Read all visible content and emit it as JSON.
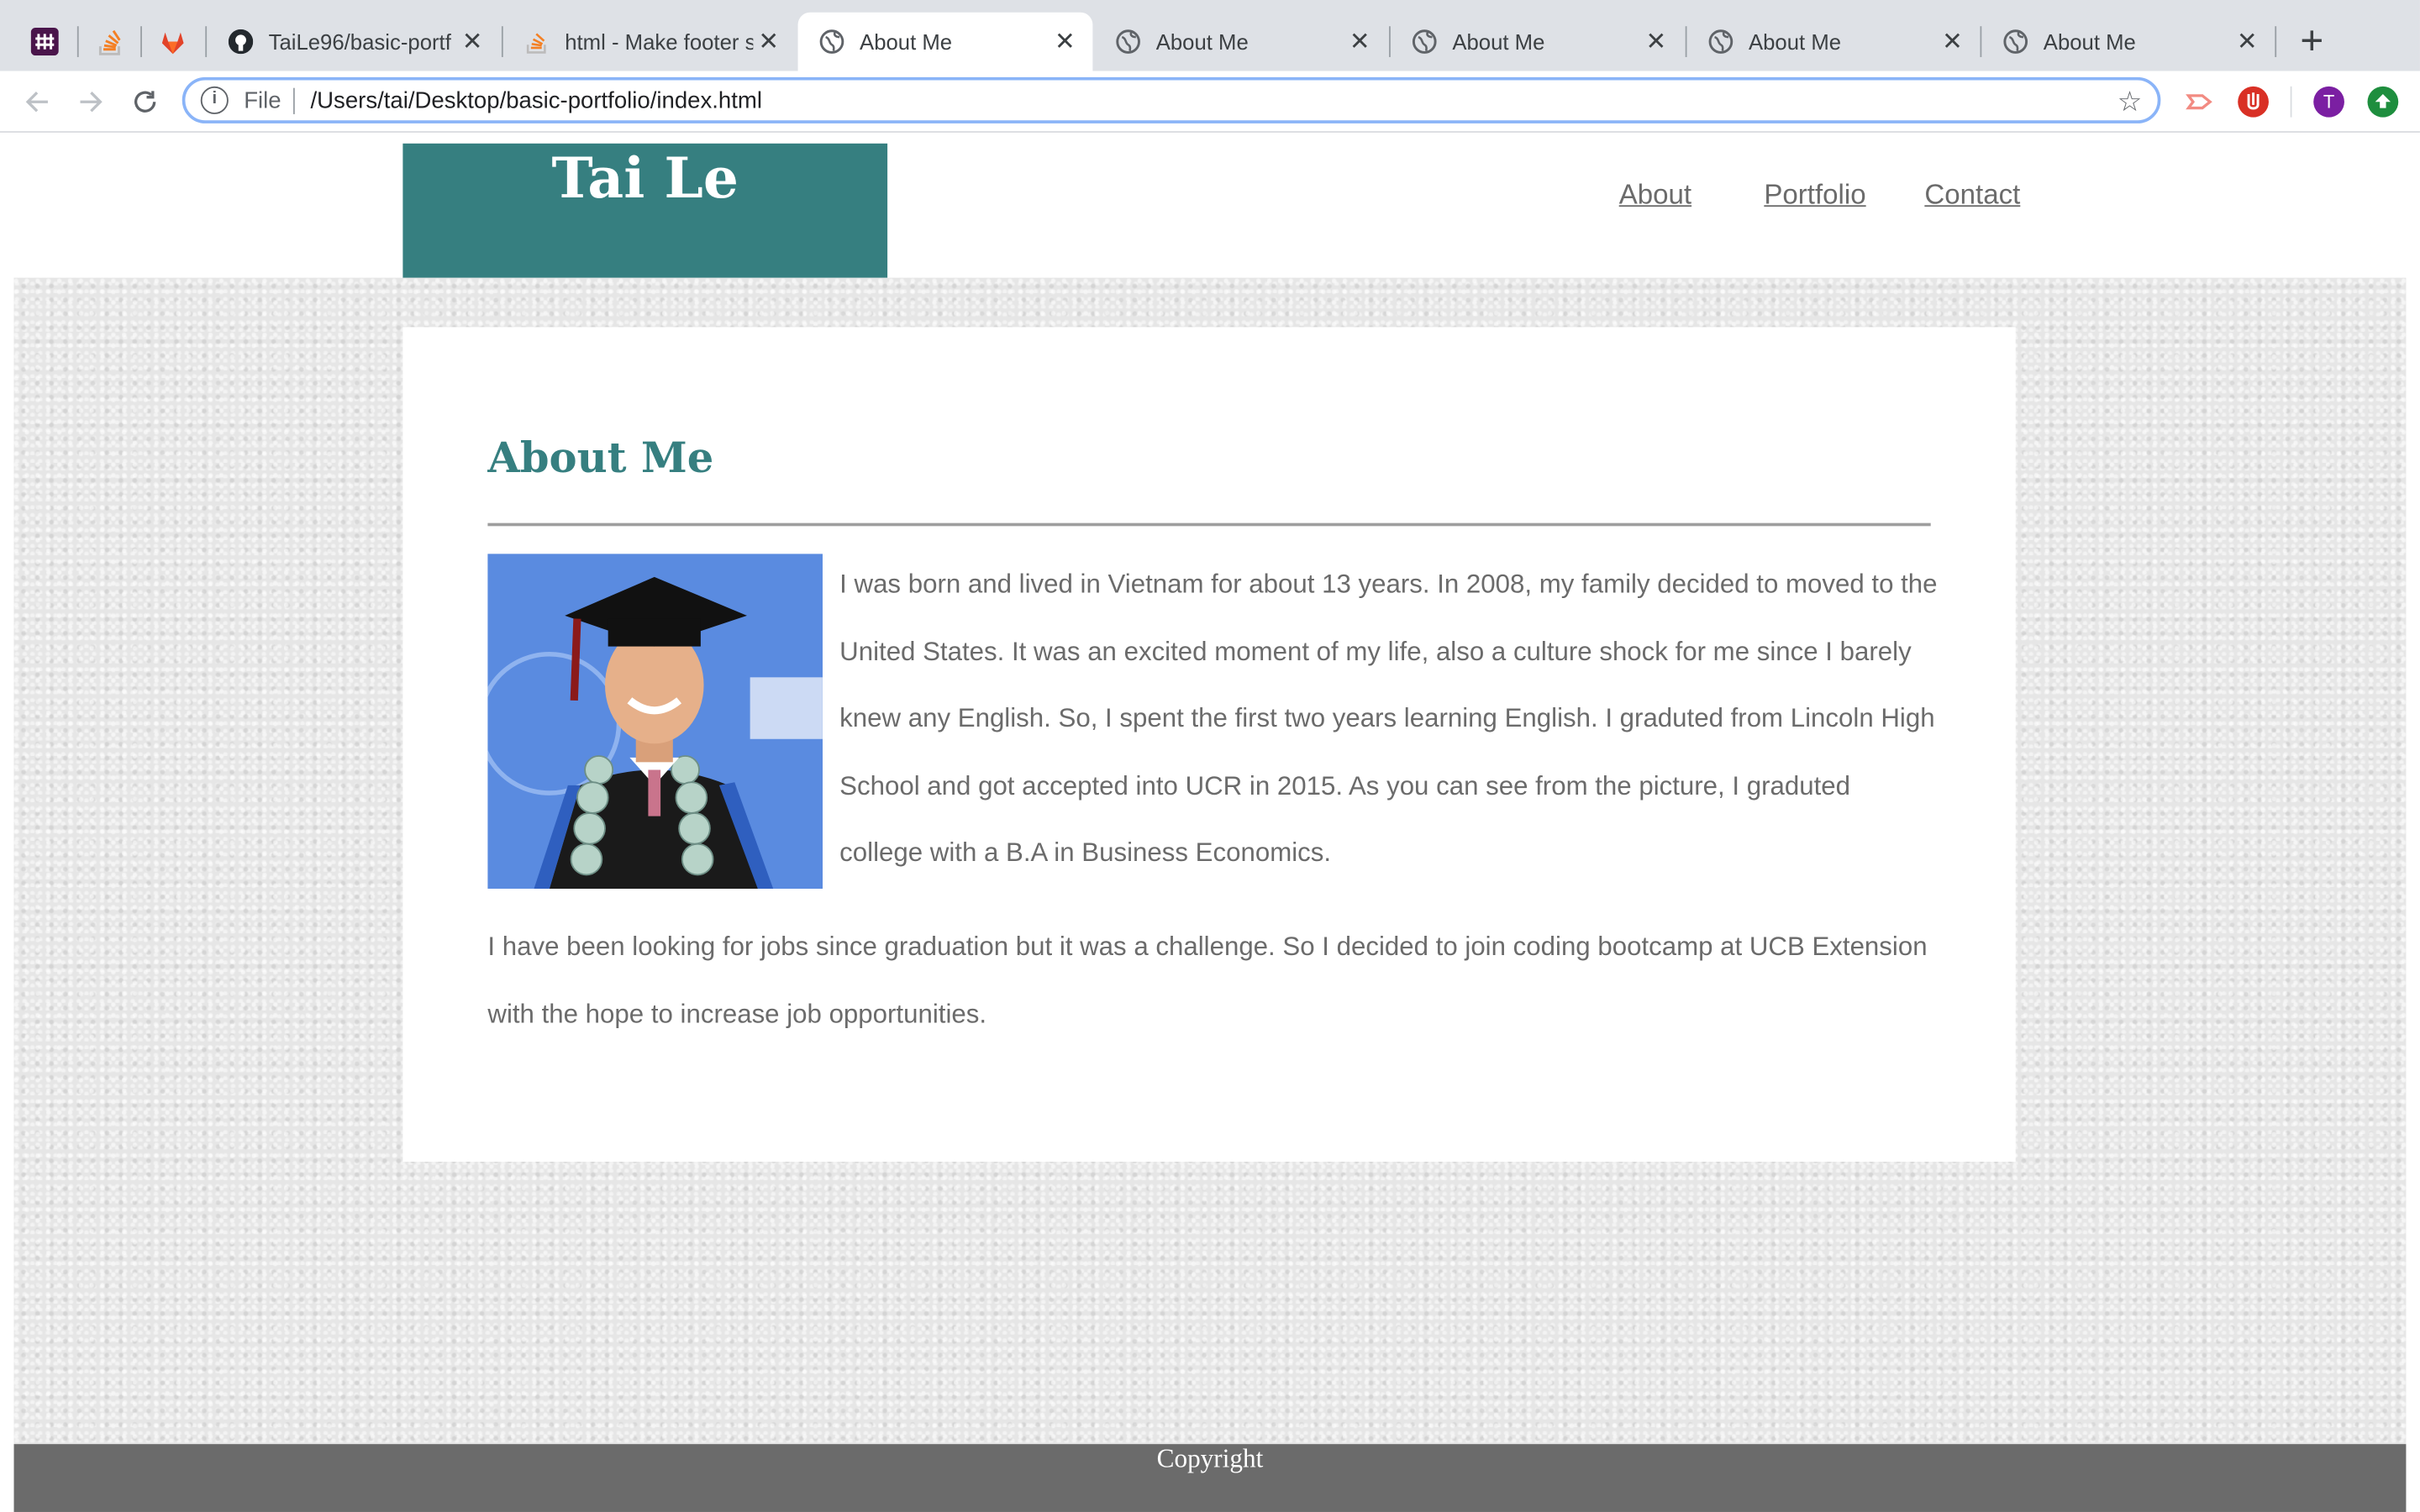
{
  "browser": {
    "tabs": [
      {
        "title": "TaiLe96/basic-portf",
        "icon": "github-icon"
      },
      {
        "title": "html - Make footer s",
        "icon": "stackoverflow-icon"
      },
      {
        "title": "About Me",
        "icon": "globe-icon",
        "active": true
      },
      {
        "title": "About Me",
        "icon": "globe-icon"
      },
      {
        "title": "About Me",
        "icon": "globe-icon"
      },
      {
        "title": "About Me",
        "icon": "globe-icon"
      },
      {
        "title": "About Me",
        "icon": "globe-icon"
      }
    ],
    "omnibox": {
      "scheme_label": "File",
      "url": "/Users/tai/Desktop/basic-portfolio/index.html"
    },
    "profile_initial": "T"
  },
  "site": {
    "brand": "Tai Le",
    "nav": {
      "about": "About",
      "portfolio": "Portfolio",
      "contact": "Contact"
    },
    "section_title": "About Me",
    "paragraph1": "I was born and lived in Vietnam for about 13 years. In 2008, my family decided to moved to the United States. It was an excited moment of my life, also a culture shock for me since I barely knew any English. So, I spent the first two years learning English. I graduted from Lincoln High School and got accepted into UCR in 2015. As you can see from the picture, I graduted college with a B.A in Business Economics.",
    "paragraph2": "I have been looking for jobs since graduation but it was a challenge. So I decided to join coding bootcamp at UCB Extension with the hope to increase job opportunities.",
    "footer": "Copyright"
  },
  "colors": {
    "brand_teal": "#367f80",
    "footer_gray": "#6b6b6b",
    "text_gray": "#6b6b6b"
  }
}
